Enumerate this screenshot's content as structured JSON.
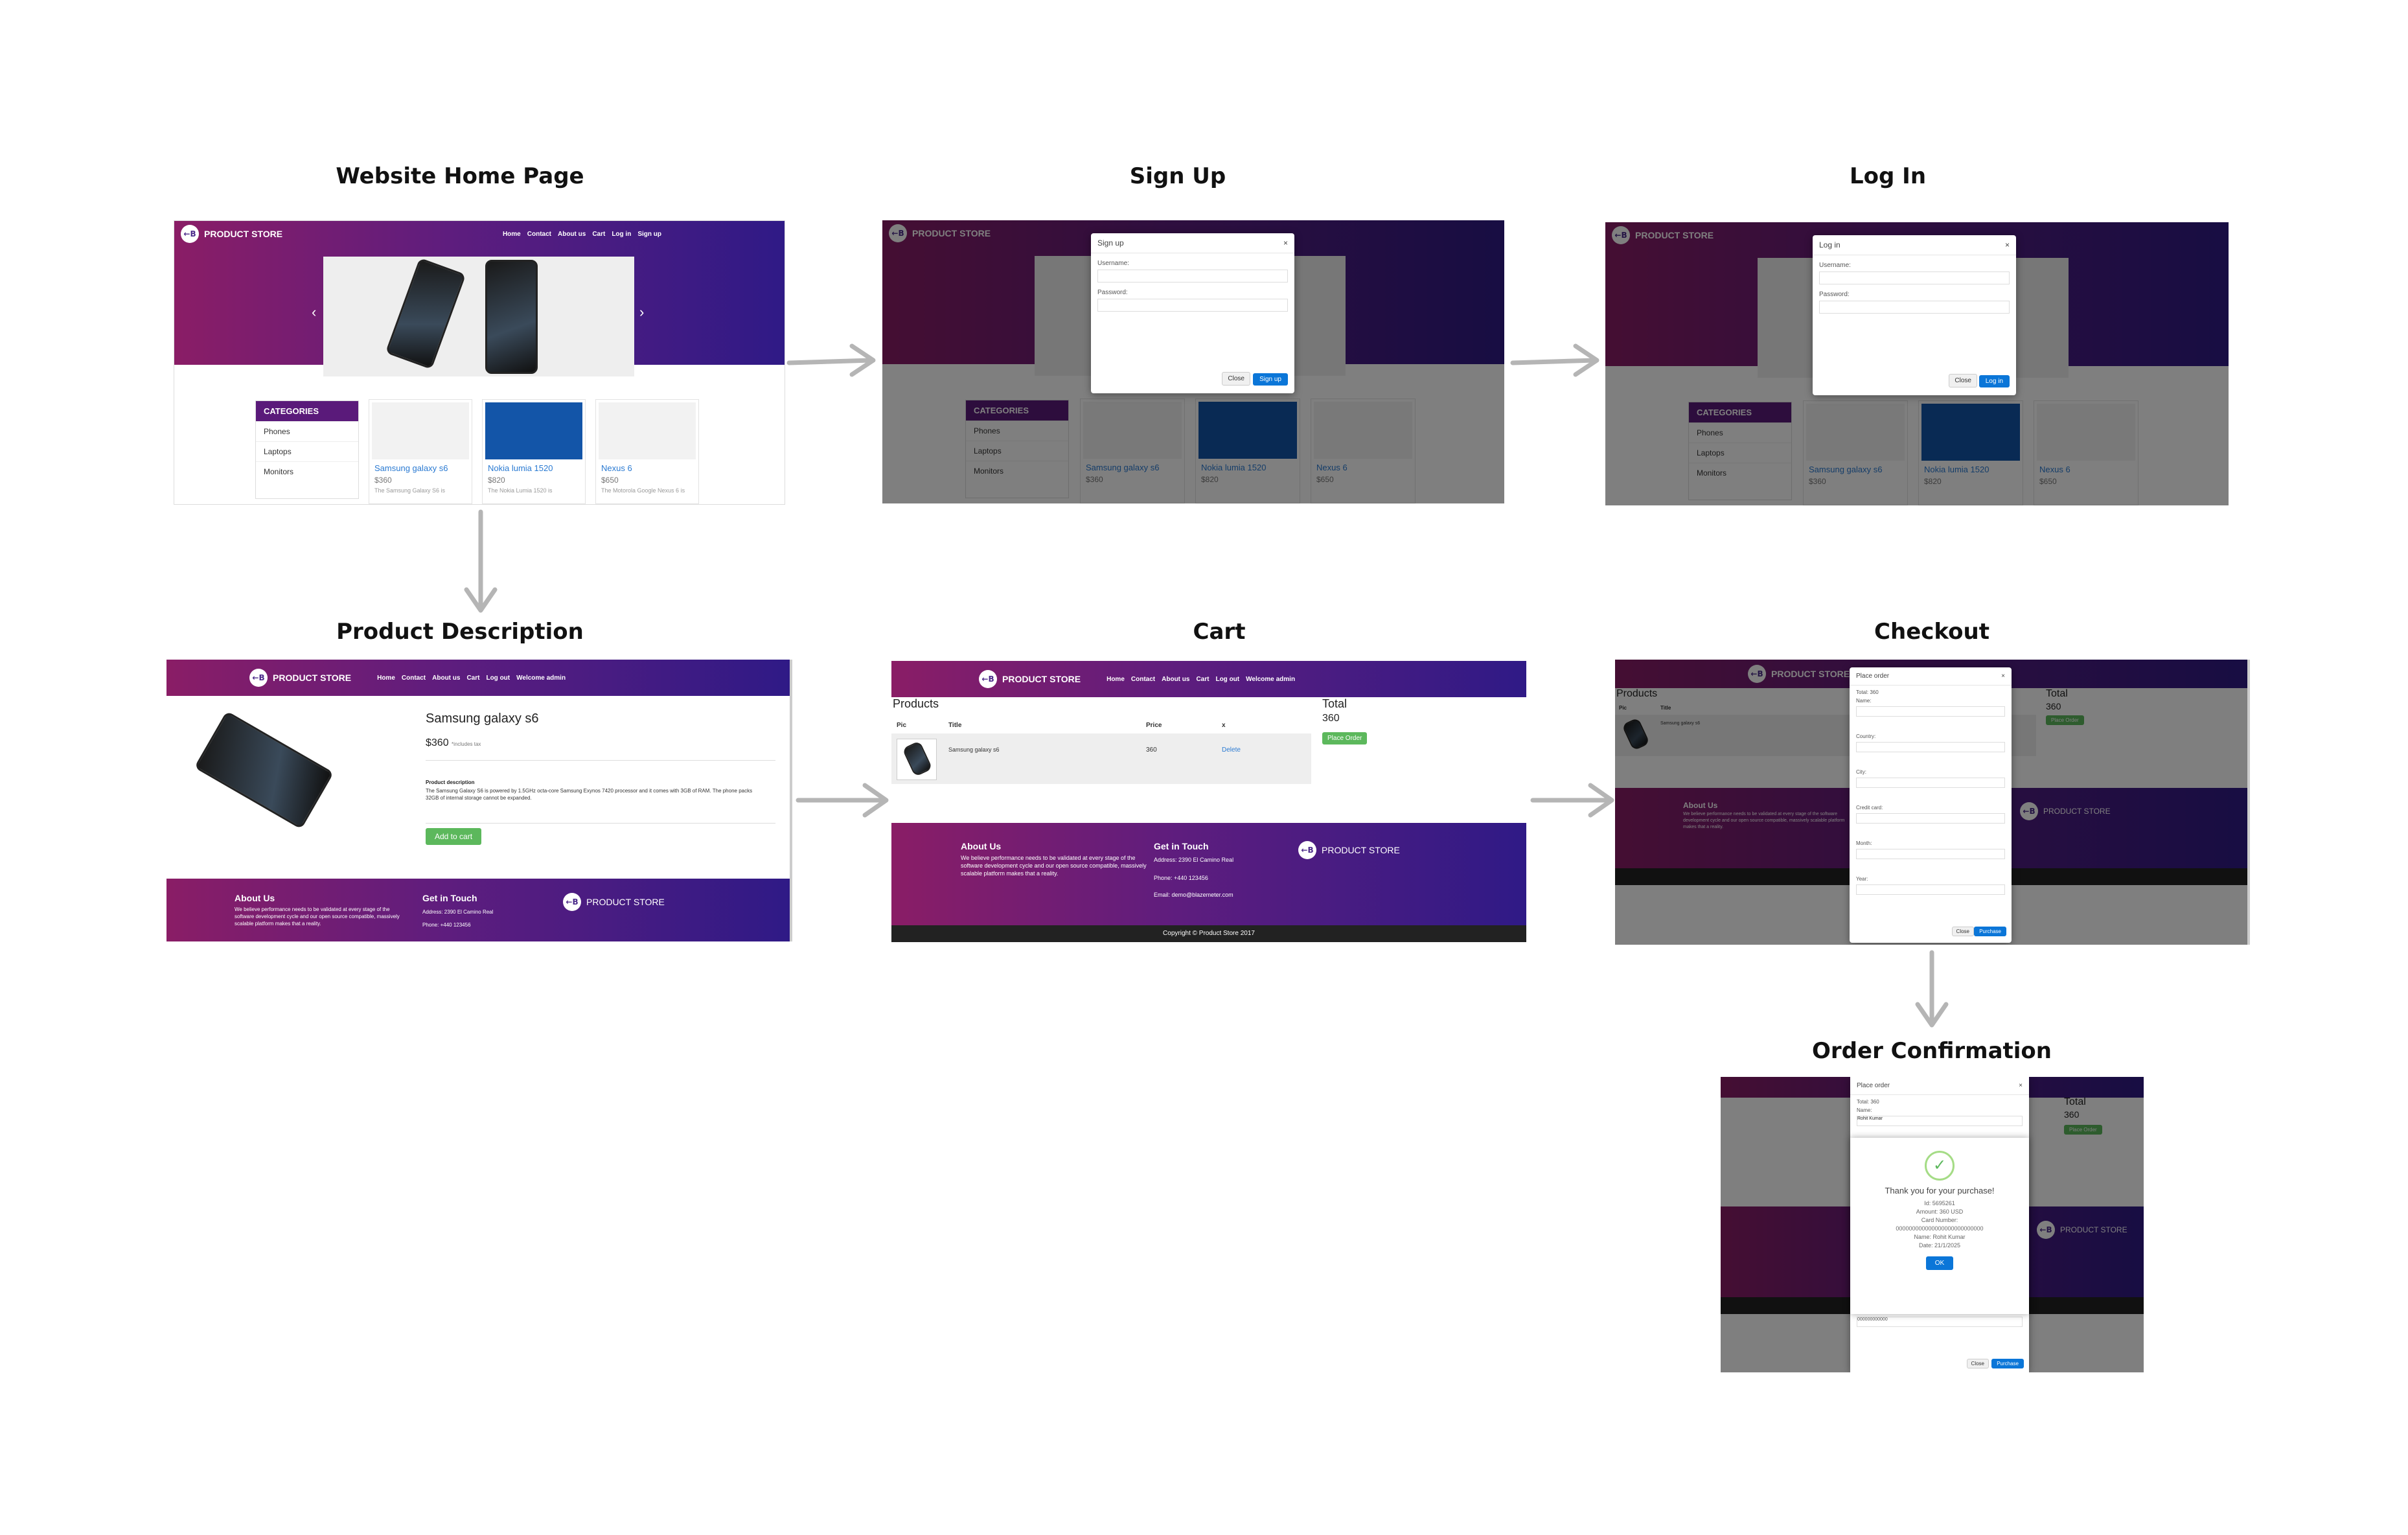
{
  "panels": {
    "home": "Website Home Page",
    "signup": "Sign Up",
    "login": "Log In",
    "product": "Product Description",
    "cart": "Cart",
    "checkout": "Checkout",
    "confirm": "Order Confirmation"
  },
  "site": {
    "brand": "PRODUCT STORE",
    "logo": "←B",
    "nav_guest": [
      "Home",
      "Contact",
      "About us",
      "Cart",
      "Log in",
      "Sign up"
    ],
    "nav_user": [
      "Home",
      "Contact",
      "About us",
      "Cart",
      "Log out",
      "Welcome admin"
    ],
    "categories_title": "CATEGORIES",
    "categories": [
      "Phones",
      "Laptops",
      "Monitors"
    ],
    "products": [
      {
        "name": "Samsung galaxy s6",
        "price": "$360",
        "desc": "The Samsung Galaxy S6 is"
      },
      {
        "name": "Nokia lumia 1520",
        "price": "$820",
        "desc": "The Nokia Lumia 1520 is"
      },
      {
        "name": "Nexus 6",
        "price": "$650",
        "desc": "The Motorola Google Nexus 6 is"
      }
    ],
    "prev_icon": "‹",
    "next_icon": "›"
  },
  "signup_modal": {
    "title": "Sign up",
    "close_x": "×",
    "username": "Username:",
    "password": "Password:",
    "close": "Close",
    "submit": "Sign up"
  },
  "login_modal": {
    "title": "Log in",
    "close_x": "×",
    "username": "Username:",
    "password": "Password:",
    "close": "Close",
    "submit": "Log in"
  },
  "product_page": {
    "name": "Samsung galaxy s6",
    "price": "$360",
    "tax": "*includes tax",
    "desc_title": "Product description",
    "desc": "The Samsung Galaxy S6 is powered by 1.5GHz octa-core Samsung Exynos 7420 processor and it comes with 3GB of RAM. The phone packs 32GB of internal storage cannot be expanded.",
    "add_to_cart": "Add to cart"
  },
  "footer": {
    "about_title": "About Us",
    "about_text": "We believe performance needs to be validated at every stage of the software development cycle and our open source compatible, massively scalable platform makes that a reality.",
    "touch_title": "Get in Touch",
    "address": "Address: 2390 El Camino Real",
    "phone": "Phone: +440 123456",
    "email": "Email: demo@blazemeter.com",
    "copyright": "Copyright © Product Store 2017"
  },
  "cart_page": {
    "products_title": "Products",
    "total_title": "Total",
    "total_value": "360",
    "headers": [
      "Pic",
      "Title",
      "Price",
      "x"
    ],
    "row": {
      "title": "Samsung galaxy s6",
      "price": "360",
      "action": "Delete"
    },
    "place_order": "Place Order"
  },
  "order_modal": {
    "title": "Place order",
    "close_x": "×",
    "total": "Total: 360",
    "fields": [
      "Name:",
      "Country:",
      "City:",
      "Credit card:",
      "Month:",
      "Year:"
    ],
    "close": "Close",
    "purchase": "Purchase"
  },
  "confirmation": {
    "check_icon": "✓",
    "heading": "Thank you for your purchase!",
    "lines": [
      "Id: 5695261",
      "Amount: 360 USD",
      "Card Number:",
      "000000000000000000000000000",
      "Name: Rohit Kumar",
      "Date: 21/1/2025"
    ],
    "ok": "OK",
    "name_value": "Rohit Kumar",
    "card_value": "000000000000"
  }
}
